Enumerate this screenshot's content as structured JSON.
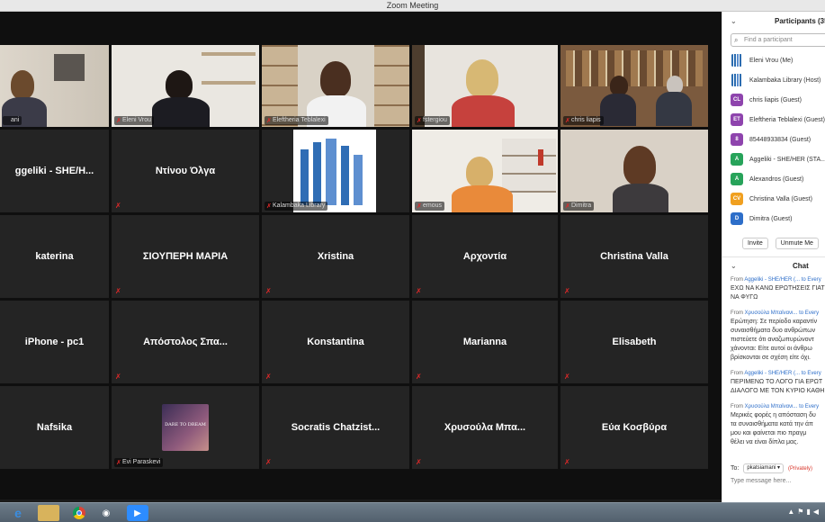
{
  "window": {
    "title": "Zoom Meeting"
  },
  "tiles": {
    "r1": [
      {
        "label": "ani"
      },
      {
        "label": "Eleni Vrou"
      },
      {
        "label": "Eleftheria Teblalexi"
      },
      {
        "label": "fstergiou"
      },
      {
        "label": "chris liapis"
      }
    ],
    "r2": [
      {
        "name": "ggeliki - SHE/H..."
      },
      {
        "name": "Ντίνου Όλγα"
      },
      {
        "label": "Kalambaka Library"
      },
      {
        "label": "emous"
      },
      {
        "label": "Dimitra"
      }
    ],
    "r3": [
      "katerina",
      "ΣΙΟΥΠΕΡΗ ΜΑΡΙΑ",
      "Xristina",
      "Αρχοντία",
      "Christina Valla"
    ],
    "r4": [
      "iPhone - pc1",
      "Απόστολος Σπα...",
      "Konstantina",
      "Marianna",
      "Elisabeth"
    ],
    "r5": [
      {
        "name": "Nafsika"
      },
      {
        "label": "Evi Paraskevi",
        "logo_text": "DARE TO DREAM"
      },
      {
        "name": "Socratis Chatzist..."
      },
      {
        "name": "Χρυσούλα Μπα..."
      },
      {
        "name": "Εύα Κοσβύρα"
      }
    ]
  },
  "participants": {
    "title": "Participants (35)",
    "search_placeholder": "Find a participant",
    "list": [
      {
        "initials": "",
        "name": "Eleni Vrou (Me)",
        "color": "logo"
      },
      {
        "initials": "",
        "name": "Kalambaka Library (Host)",
        "color": "logo"
      },
      {
        "initials": "CL",
        "name": "chris liapis (Guest)",
        "color": "#8e44ad"
      },
      {
        "initials": "ET",
        "name": "Eleftheria Teblalexi (Guest)",
        "color": "#8e44ad"
      },
      {
        "initials": "8",
        "name": "85448933834 (Guest)",
        "color": "#8e44ad"
      },
      {
        "initials": "A",
        "name": "Aggeliki - SHE/HER (STA...",
        "color": "#27a35a"
      },
      {
        "initials": "A",
        "name": "Alexandros (Guest)",
        "color": "#27a35a"
      },
      {
        "initials": "CV",
        "name": "Christina Valla (Guest)",
        "color": "#f0a020"
      },
      {
        "initials": "D",
        "name": "Dimitra (Guest)",
        "color": "#2d6ec9"
      }
    ],
    "invite_label": "Invite",
    "unmute_label": "Unmute Me"
  },
  "chat": {
    "title": "Chat",
    "messages": [
      {
        "from": "From",
        "sender": "Aggeliki - SHE/HER (...",
        "to": "to Every",
        "lines": [
          "ΕΧΩ ΝΑ ΚΑΝΩ ΕΡΩΤΗΣΕΙΣ ΓΙΑΤ",
          "ΝΑ ΦΥΓΩ"
        ]
      },
      {
        "from": "From",
        "sender": "Χρυσούλα Μπαϊνανι...",
        "to": "to Every",
        "lines": [
          "Ερώτηση: Σε περίοδο καραντίν",
          "συναισθήματα δυο ανθρώπων",
          "πιστεύετε ότι αναζωπυρώνοντ",
          "χάνονται: Είτε αυτοί οι άνθρω",
          "βρίσκονται σε σχέση είτε όχι."
        ]
      },
      {
        "from": "From",
        "sender": "Aggeliki - SHE/HER (...",
        "to": "to Every",
        "lines": [
          "ΠΕΡΙΜΕΝΩ ΤΟ ΛΟΓΟ ΓΙΑ ΕΡΩΤ",
          "ΔΙΑΛΟΓΟ ΜΕ ΤΟΝ ΚΥΡΙΟ ΚΑΘΗ"
        ]
      },
      {
        "from": "From",
        "sender": "Χρυσούλα Μπαϊνανι...",
        "to": "to Every",
        "lines": [
          "Μερικές φορές η απόσταση δυ",
          "τα συναισθήματα κατά την άπ",
          "μου και φαίνεται πιο πραγμ",
          "θέλει να είναι δίπλα μας."
        ]
      }
    ],
    "to_label": "To:",
    "to_value": "pkatsiamani ▾",
    "privately": "(Privately)",
    "input_placeholder": "Type message here..."
  }
}
